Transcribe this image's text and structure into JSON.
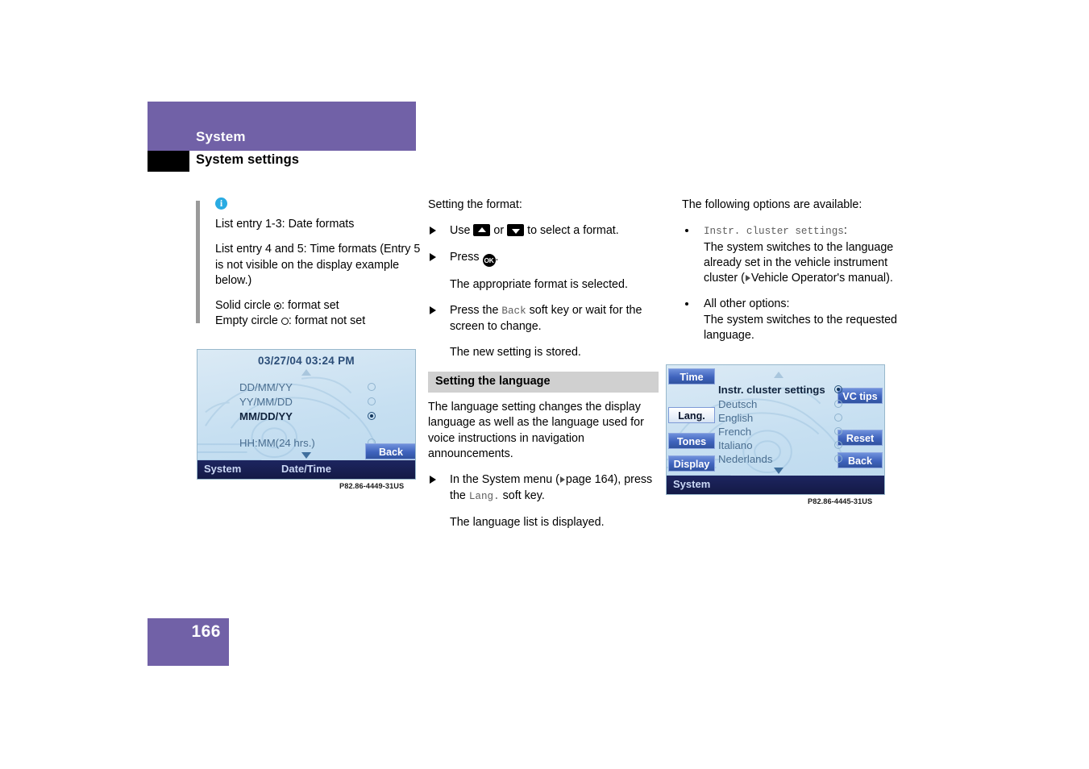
{
  "header": {
    "chapter": "System",
    "section": "System settings"
  },
  "page_number": "166",
  "col1": {
    "info_icon": "info-icon",
    "note_line_1": "List entry 1-3: Date formats",
    "note_line_2": "List entry 4 and 5: Time formats (Entry 5 is not visible on the display example below.)",
    "legend_solid_pre": "Solid circle",
    "legend_solid_post": ": format set",
    "legend_empty_pre": "Empty circle",
    "legend_empty_post": ": format not set"
  },
  "col2": {
    "lead": "Setting the format:",
    "step1_a": "Use",
    "step1_b": "or",
    "step1_c": "to select a format.",
    "step2_a": "Press",
    "step2_b": ".",
    "result1": "The appropriate format is selected.",
    "step3_a": "Press the",
    "step3_key": "Back",
    "step3_b": "soft key or wait for the screen to change.",
    "result2": "The new setting is stored.",
    "subhead": "Setting the language",
    "para": "The language setting changes the display language as well as the language used for voice instructions in navigation announcements.",
    "step4_a": "In the System menu (",
    "step4_b": "page 164), press the",
    "step4_key": "Lang.",
    "step4_c": "soft key.",
    "result3": "The language list is displayed."
  },
  "col3": {
    "lead": "The following options are available:",
    "bullet1_key": "Instr. cluster settings",
    "bullet1_colon": ":",
    "bullet1_text_a": "The system switches to the language already set in the vehicle instrument cluster (",
    "bullet1_text_b": "Vehicle Operator's manual).",
    "bullet2_title": "All other options:",
    "bullet2_text": "The system switches to the requested language."
  },
  "device1": {
    "status": "03/27/04  03:24 PM",
    "options": [
      {
        "label": "DD/MM/YY",
        "selected": false
      },
      {
        "label": "YY/MM/DD",
        "selected": false
      },
      {
        "label": "MM/DD/YY",
        "selected": true
      },
      {
        "label": "HH:MM(24 hrs.)",
        "selected": false
      }
    ],
    "softkey_back": "Back",
    "bottom_left": "System",
    "bottom_center": "Date/Time",
    "caption": "P82.86-4449-31US"
  },
  "device2": {
    "left_softkeys": [
      {
        "label": "Time",
        "active": false
      },
      {
        "label": "Lang.",
        "active": true
      },
      {
        "label": "Tones",
        "active": false
      },
      {
        "label": "Display",
        "active": false
      }
    ],
    "right_softkeys": [
      {
        "label": "VC tips",
        "active": false
      },
      {
        "label": "Reset",
        "active": false
      },
      {
        "label": "Back",
        "active": false
      }
    ],
    "options": [
      {
        "label": "Instr. cluster settings",
        "selected": true
      },
      {
        "label": "Deutsch",
        "selected": false
      },
      {
        "label": "English",
        "selected": false
      },
      {
        "label": "French",
        "selected": false
      },
      {
        "label": "Italiano",
        "selected": false
      },
      {
        "label": "Nederlands",
        "selected": false
      }
    ],
    "bottom_left": "System",
    "caption": "P82.86-4445-31US"
  },
  "colors": {
    "brand_purple": "#7161a7",
    "info_blue": "#29abe2",
    "subhead_gray": "#d0d0d0",
    "softkey_blue": "#3f63bd",
    "display_bar_navy": "#141a46"
  }
}
